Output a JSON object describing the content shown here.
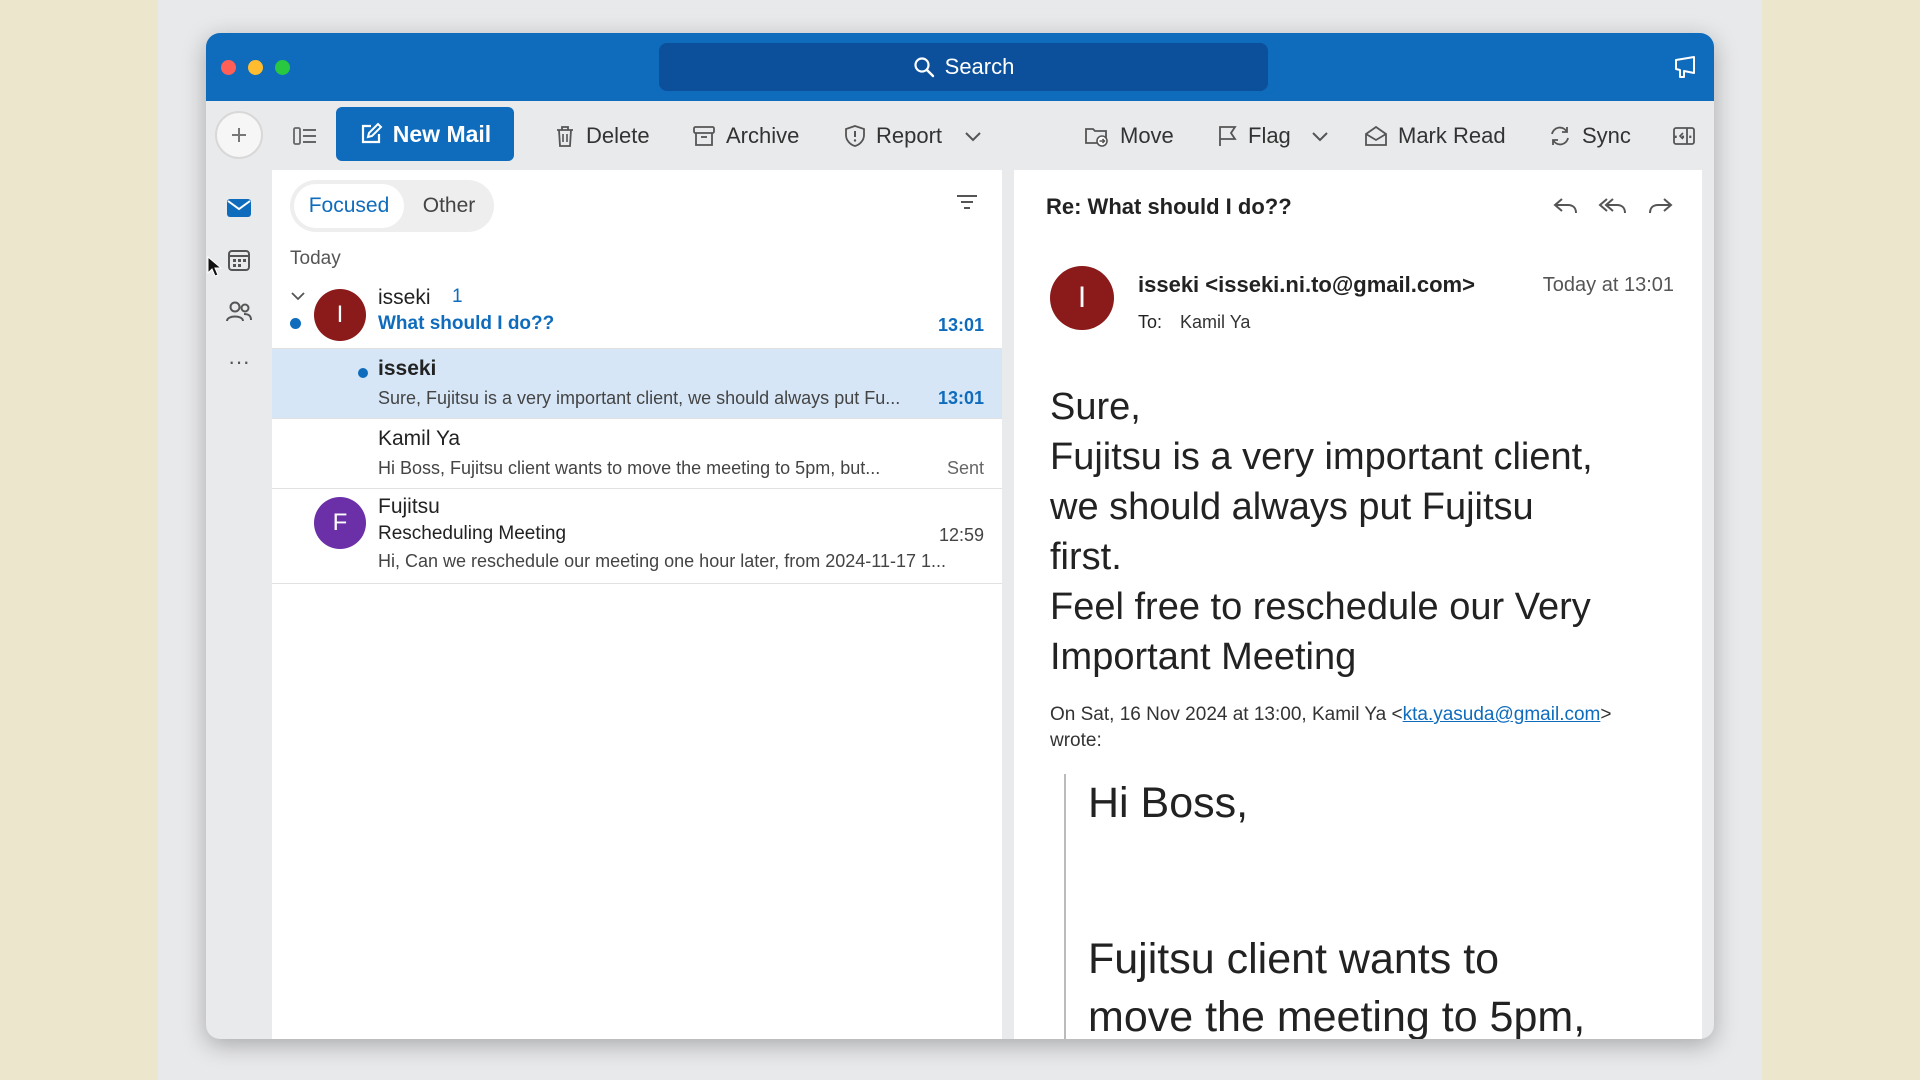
{
  "titlebar": {
    "search_label": "Search"
  },
  "toolbar": {
    "new_mail": "New Mail",
    "delete": "Delete",
    "archive": "Archive",
    "report": "Report",
    "move": "Move",
    "flag": "Flag",
    "mark_read": "Mark Read",
    "sync": "Sync",
    "more": "···"
  },
  "rail": {
    "more": "···"
  },
  "list": {
    "tabs": {
      "focused": "Focused",
      "other": "Other"
    },
    "group_label": "Today",
    "thread": {
      "avatar_initial": "I",
      "sender": "isseki",
      "count": "1",
      "subject": "What should I do??",
      "time": "13:01"
    },
    "items": [
      {
        "sender": "isseki",
        "preview": "Sure, Fujitsu is a very important client, we should always put Fu...",
        "time": "13:01"
      },
      {
        "sender": "Kamil Ya",
        "preview": "Hi Boss, Fujitsu client wants to move the meeting to 5pm, but...",
        "time": "Sent"
      },
      {
        "avatar_initial": "F",
        "sender": "Fujitsu",
        "subject": "Rescheduling Meeting",
        "preview": "Hi, Can we reschedule our meeting one hour later, from 2024-11-17 1...",
        "time": "12:59"
      }
    ]
  },
  "reading": {
    "subject": "Re: What should I do??",
    "avatar_initial": "I",
    "from": "isseki <isseki.ni.to@gmail.com>",
    "to_label": "To:",
    "to_value": "Kamil Ya",
    "date": "Today at 13:01",
    "body_lines": [
      "Sure,",
      "Fujitsu is a very important client,",
      "we should always put Fujitsu",
      "first.",
      "Feel free to reschedule our Very",
      "Important Meeting"
    ],
    "quote_header_prefix": "On Sat, 16 Nov 2024 at 13:00, Kamil Ya <",
    "quote_header_email": "kta.yasuda@gmail.com",
    "quote_header_suffix": ">",
    "quote_header_wrote": "wrote:",
    "quote_lines": [
      "Hi Boss,",
      "Fujitsu client wants to",
      "move the meeting to 5pm,"
    ]
  },
  "colors": {
    "accent": "#0f6cbd",
    "isseki_avatar": "#8b1a1a",
    "fujitsu_avatar": "#6b2fa8"
  }
}
